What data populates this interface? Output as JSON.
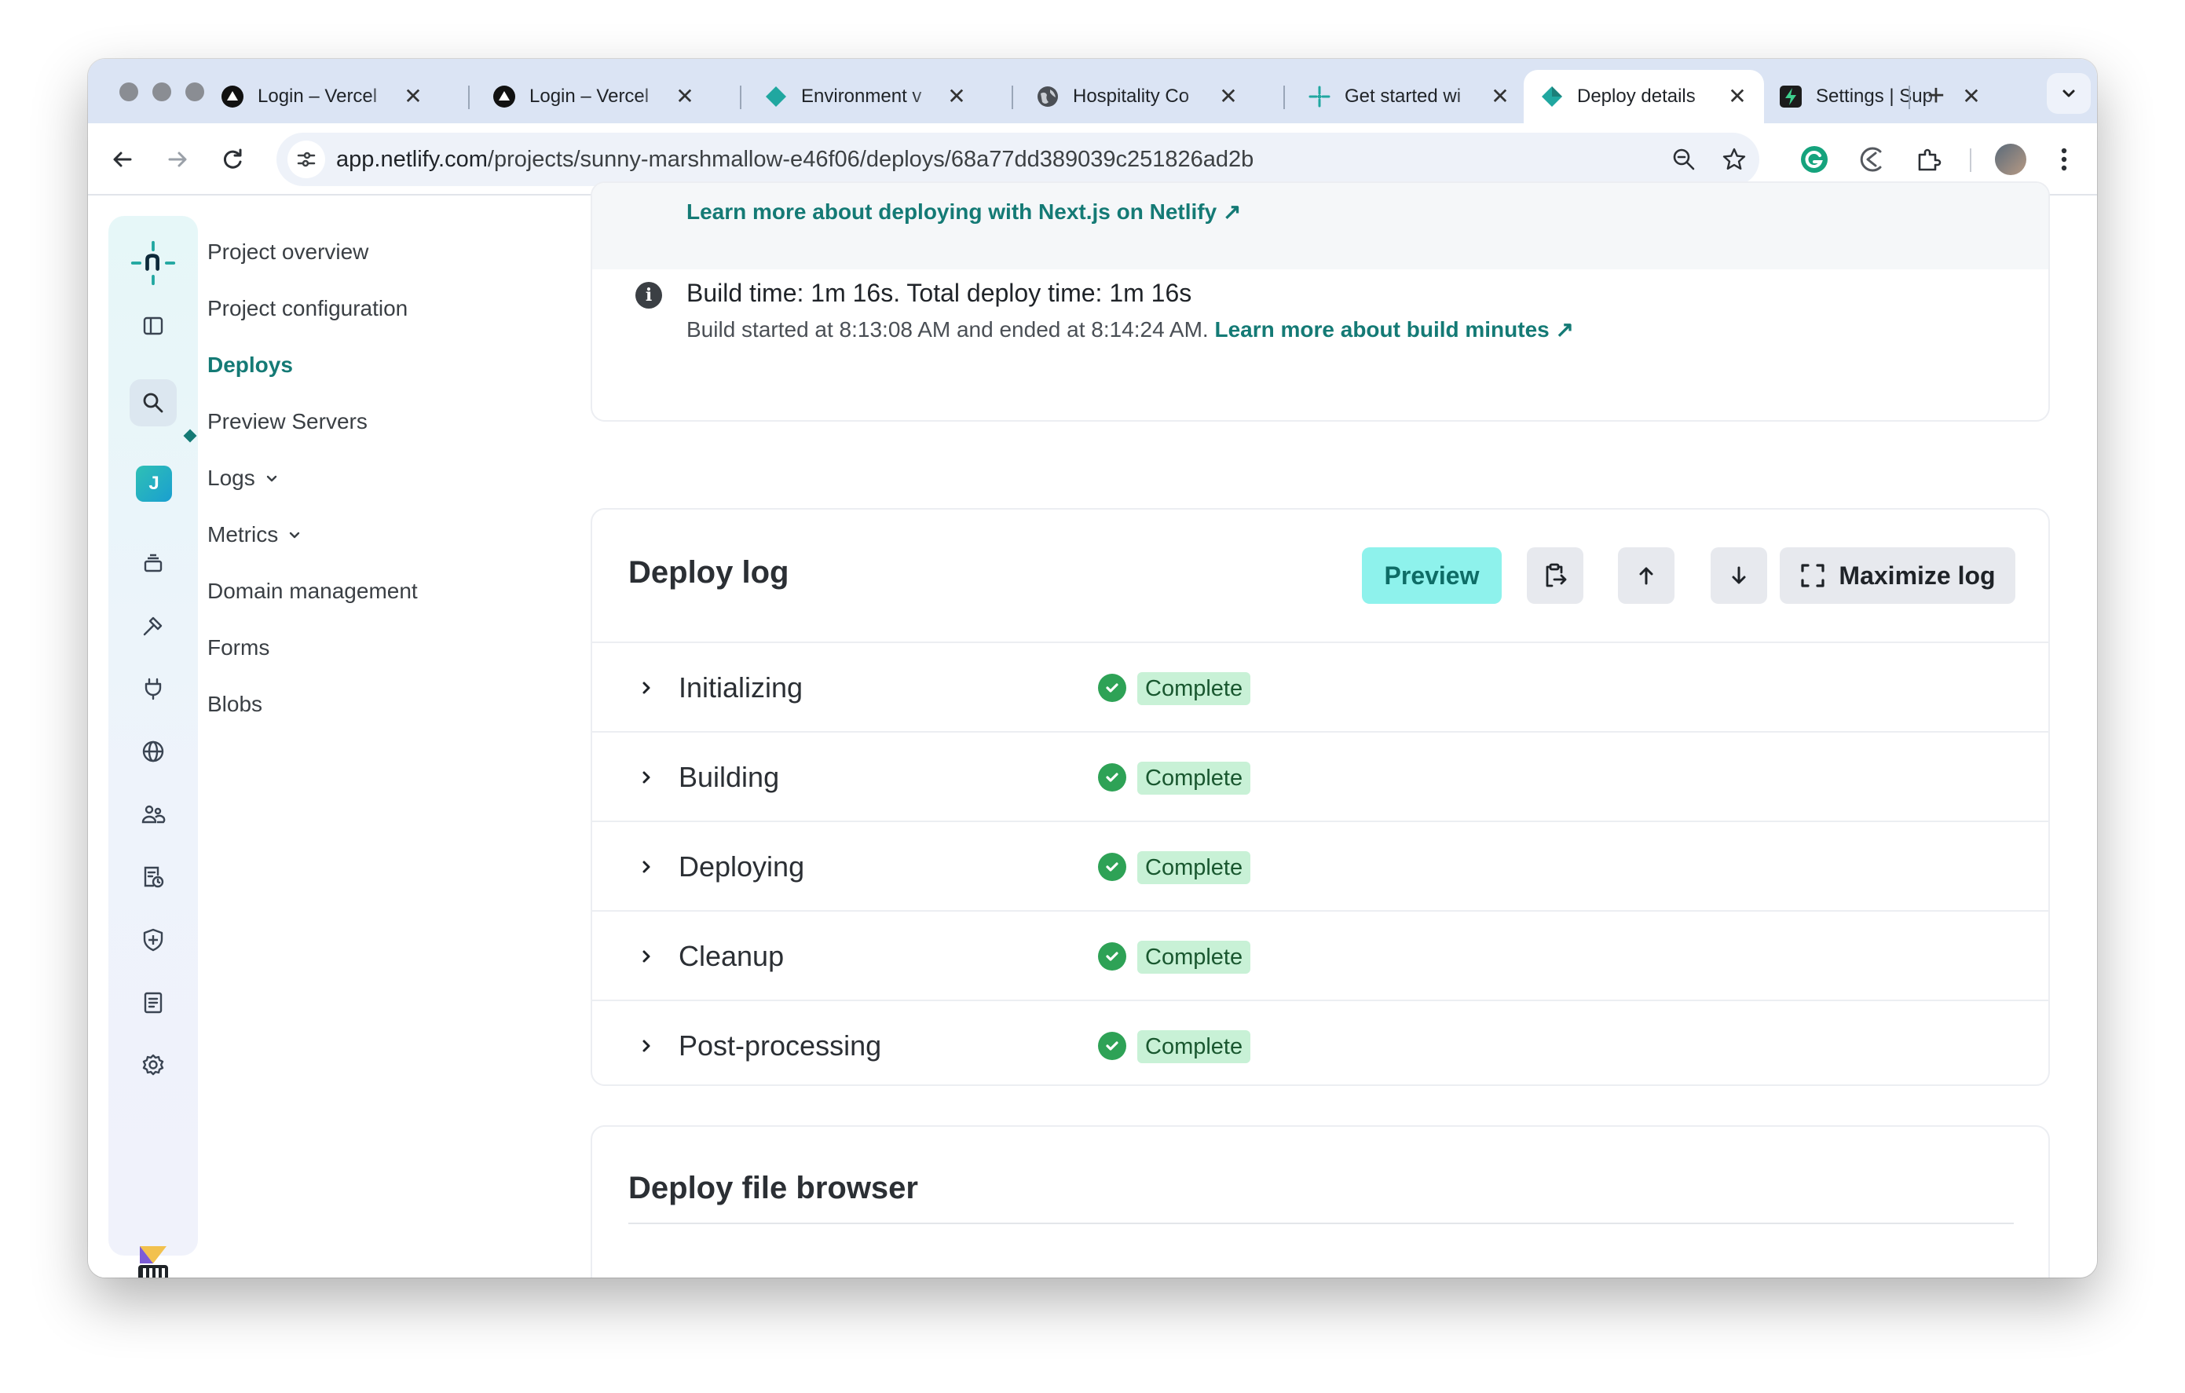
{
  "browser": {
    "tabs": [
      {
        "title": "Login – Vercel",
        "icon": "vercel-icon",
        "active": false
      },
      {
        "title": "Login – Vercel",
        "icon": "vercel-icon",
        "active": false
      },
      {
        "title": "Environment v",
        "icon": "netlify-icon",
        "active": false
      },
      {
        "title": "Hospitality Co",
        "icon": "globe-icon",
        "active": false
      },
      {
        "title": "Get started wi",
        "icon": "netlify-sparkle-icon",
        "active": false
      },
      {
        "title": "Deploy details",
        "icon": "netlify-icon",
        "active": true
      },
      {
        "title": "Settings | Sup",
        "icon": "supabase-icon",
        "active": false
      }
    ],
    "close_glyph": "✕",
    "new_tab_glyph": "+",
    "url_host": "app.netlify.com",
    "url_path": "/projects/sunny-marshmallow-e46f06/deploys/68a77dd389039c251826ad2b"
  },
  "sidebar_rail": {
    "logo": "netlify-logo",
    "user_initial": "J",
    "icons": [
      "panel-toggle-icon",
      "search-icon",
      "team-avatar",
      "layers-icon",
      "build-hammer-icon",
      "plug-icon",
      "globe-icon",
      "team-members-icon",
      "docs-clock-icon",
      "shield-icon",
      "audit-log-icon",
      "settings-gear-icon"
    ]
  },
  "project_nav": {
    "items": [
      {
        "label": "Project overview",
        "active": false,
        "dropdown": false
      },
      {
        "label": "Project configuration",
        "active": false,
        "dropdown": false
      },
      {
        "label": "Deploys",
        "active": true,
        "dropdown": false
      },
      {
        "label": "Preview Servers",
        "active": false,
        "dropdown": false
      },
      {
        "label": "Logs",
        "active": false,
        "dropdown": true
      },
      {
        "label": "Metrics",
        "active": false,
        "dropdown": true
      },
      {
        "label": "Domain management",
        "active": false,
        "dropdown": false
      },
      {
        "label": "Forms",
        "active": false,
        "dropdown": false
      },
      {
        "label": "Blobs",
        "active": false,
        "dropdown": false
      }
    ]
  },
  "summary": {
    "learn_link": "Learn more about deploying with Next.js on Netlify",
    "link_arrow": "↗",
    "build_time": "Build time: 1m 16s. Total deploy time: 1m 16s",
    "build_started": "Build started at 8:13:08 AM and ended at 8:14:24 AM.",
    "build_minutes_link": "Learn more about build minutes"
  },
  "deploy_log": {
    "title": "Deploy log",
    "preview_label": "Preview",
    "maximize_label": "Maximize log",
    "steps": [
      {
        "name": "Initializing",
        "status": "Complete"
      },
      {
        "name": "Building",
        "status": "Complete"
      },
      {
        "name": "Deploying",
        "status": "Complete"
      },
      {
        "name": "Cleanup",
        "status": "Complete"
      },
      {
        "name": "Post-processing",
        "status": "Complete"
      }
    ]
  },
  "file_browser": {
    "title": "Deploy file browser"
  },
  "colors": {
    "accent": "#147a75",
    "preview_bg": "#8ef2ec",
    "complete_bg": "#c8f1d6",
    "complete_check": "#2ea256"
  }
}
